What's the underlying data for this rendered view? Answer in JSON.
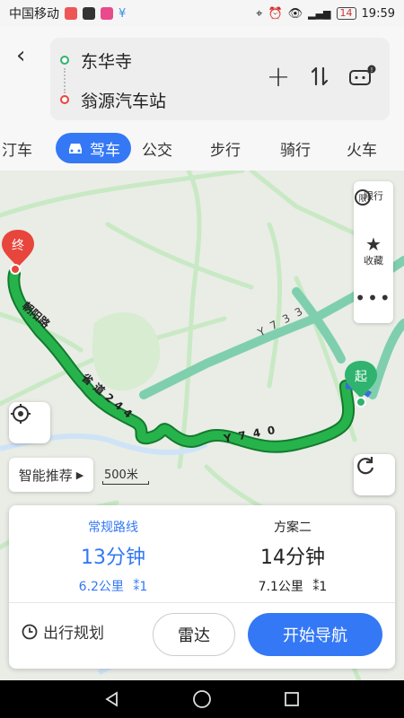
{
  "status_bar": {
    "carrier": "中国移动",
    "battery": "14",
    "time": "19:59"
  },
  "route": {
    "from": "东华寺",
    "to": "翁源汽车站"
  },
  "modes": [
    "汀车",
    "驾车",
    "公交",
    "步行",
    "骑行",
    "火车"
  ],
  "map": {
    "right_controls": [
      "限行",
      "收藏"
    ],
    "smart_recommend": "智能推荐",
    "scale": "500米",
    "road_labels": [
      "朝阳路",
      "省道244",
      "Y740",
      "Y733"
    ],
    "pin_end": "终",
    "pin_start": "起"
  },
  "plans": [
    {
      "name": "常规路线",
      "time": "13分钟",
      "distance": "6.2公里",
      "lights": "1"
    },
    {
      "name": "方案二",
      "time": "14分钟",
      "distance": "7.1公里",
      "lights": "1"
    }
  ],
  "actions": {
    "trip_plan": "出行规划",
    "radar": "雷达",
    "start_nav": "开始导航"
  },
  "colors": {
    "accent": "#3478f6",
    "route_green": "#27b34b",
    "alt_route": "#7fcfae"
  }
}
